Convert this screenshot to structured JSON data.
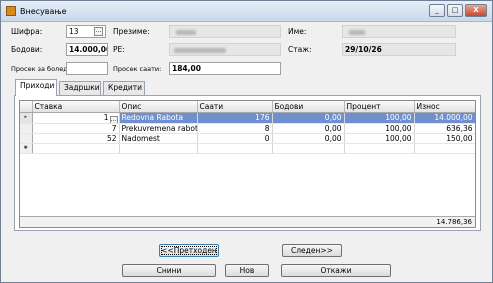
{
  "window": {
    "title": "Внесување",
    "controls": {
      "minimize": "_",
      "maximize": "□",
      "close": "X"
    }
  },
  "form": {
    "sifra": {
      "label": "Шифра:",
      "value": "13",
      "lookup": "..."
    },
    "prezime": {
      "label": "Презиме:"
    },
    "ime": {
      "label": "Име:"
    },
    "bodovi": {
      "label": "Бодови:",
      "value": "14.000,00"
    },
    "pe": {
      "label": "РЕ:"
    },
    "staz": {
      "label": "Стаж:",
      "value": "29/10/26"
    },
    "prosek_boleduvanje": {
      "label": "Просек за болед.:",
      "value": ""
    },
    "prosek_saati": {
      "label": "Просек саати:",
      "value": "184,00"
    }
  },
  "tabs": [
    {
      "label": "Приходи",
      "active": true
    },
    {
      "label": "Задршки",
      "active": false
    },
    {
      "label": "Кредити",
      "active": false
    }
  ],
  "grid": {
    "columns": [
      "Ставка",
      "Опис",
      "Саати",
      "Бодови",
      "Процент",
      "Износ"
    ],
    "rows": [
      {
        "marker": "▸",
        "stavka": "1",
        "opis": "Redovna Rabota",
        "saati": "176",
        "bodovi": "0,00",
        "procent": "100,00",
        "iznos": "14.000,00",
        "selected": true
      },
      {
        "marker": "",
        "stavka": "7",
        "opis": "Prekuvremena rabota",
        "saati": "8",
        "bodovi": "0,00",
        "procent": "100,00",
        "iznos": "636,36",
        "selected": false
      },
      {
        "marker": "",
        "stavka": "52",
        "opis": "Nadomest",
        "saati": "0",
        "bodovi": "0,00",
        "procent": "100,00",
        "iznos": "150,00",
        "selected": false
      }
    ],
    "new_row_marker": "✱",
    "total": "14.786,36"
  },
  "buttons": {
    "prev": "<<Претходен",
    "next": "Следен>>",
    "save": "Снини",
    "new": "Нов",
    "cancel": "Откажи"
  },
  "colors": {
    "selection": "#6f8fcf",
    "window_bg": "#f0f0f0"
  }
}
